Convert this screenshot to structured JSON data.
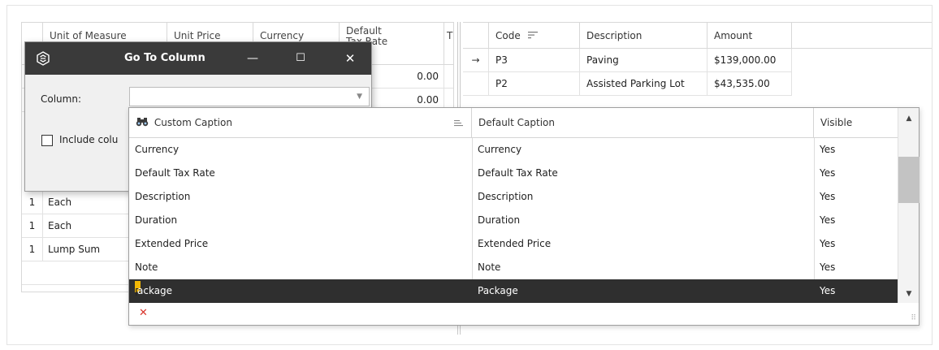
{
  "left_grid": {
    "columns": [
      "Unit of Measure",
      "Unit Price",
      "Currency",
      "Default\nTax Rate",
      "T"
    ],
    "price_values": [
      "0.00",
      "0.00"
    ],
    "rows": [
      {
        "qty": "1",
        "uom": "Each"
      },
      {
        "qty": "1",
        "uom": "Each"
      },
      {
        "qty": "1",
        "uom": "Lump Sum"
      }
    ]
  },
  "right_grid": {
    "columns": [
      "Code",
      "Description",
      "Amount"
    ],
    "rows": [
      {
        "indicator": "→",
        "code": "P3",
        "description": "Paving",
        "amount": "$139,000.00"
      },
      {
        "indicator": "",
        "code": "P2",
        "description": "Assisted Parking Lot",
        "amount": "$43,535.00"
      }
    ]
  },
  "dialog": {
    "title": "Go To Column",
    "minimize": "—",
    "maximize": "☐",
    "close": "✕",
    "column_label": "Column:",
    "column_value": "",
    "include_label": "Include colu"
  },
  "dropdown": {
    "columns": [
      "Custom Caption",
      "Default Caption",
      "Visible"
    ],
    "rows": [
      {
        "custom": "Currency",
        "default": "Currency",
        "visible": "Yes"
      },
      {
        "custom": "Default Tax Rate",
        "default": "Default Tax Rate",
        "visible": "Yes"
      },
      {
        "custom": "Description",
        "default": "Description",
        "visible": "Yes"
      },
      {
        "custom": "Duration",
        "default": "Duration",
        "visible": "Yes"
      },
      {
        "custom": "Extended Price",
        "default": "Extended Price",
        "visible": "Yes"
      },
      {
        "custom": "Note",
        "default": "Note",
        "visible": "Yes"
      },
      {
        "custom": "ackage",
        "default": "Package",
        "visible": "Yes"
      }
    ],
    "selected_first_char": "P",
    "clear_icon": "✕"
  },
  "colors": {
    "accent_dark": "#2f2f2f",
    "titlebar": "#3a3a3a",
    "clear_red": "#d9342b",
    "caret_yellow": "#f2b705"
  }
}
